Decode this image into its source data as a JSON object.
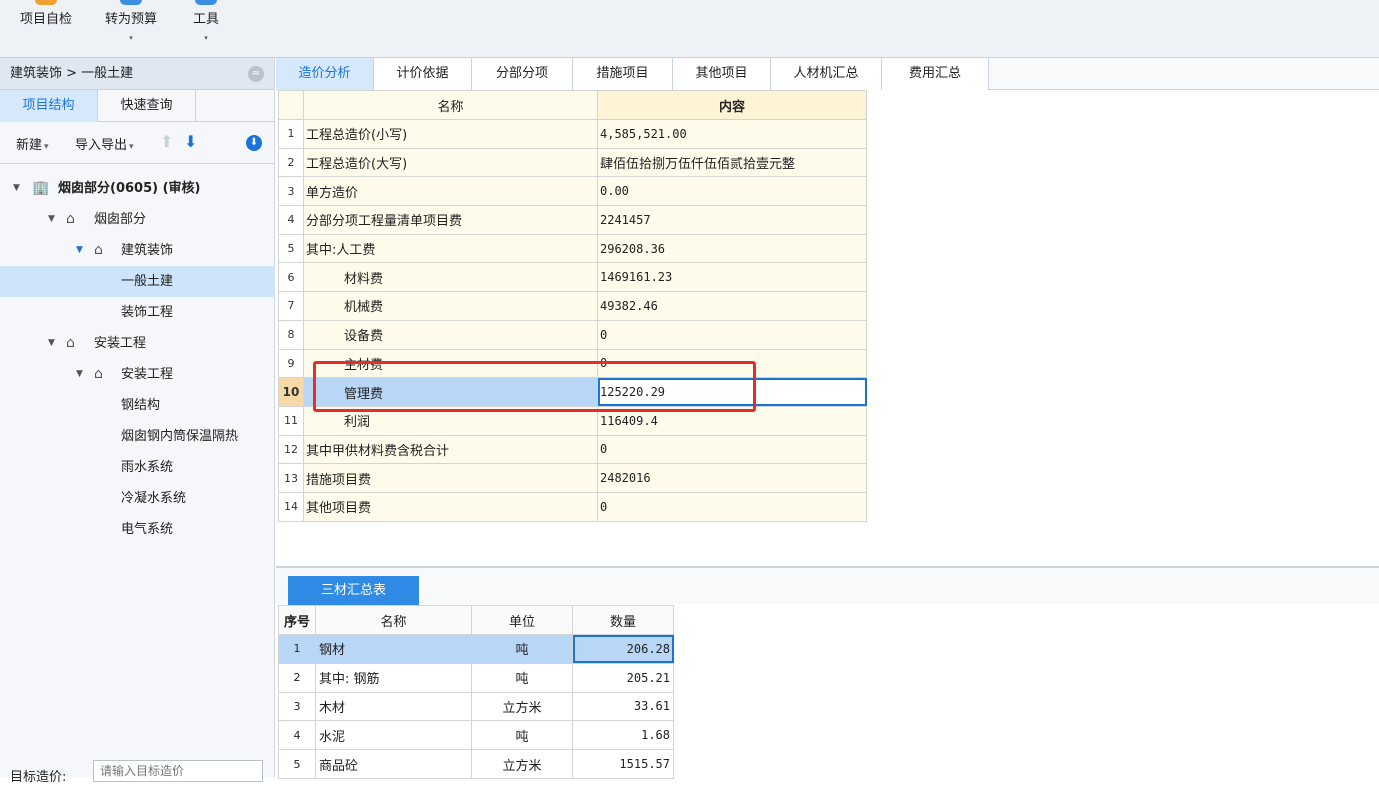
{
  "toolbar": {
    "items": [
      {
        "label": "项目自检",
        "icon": "check-icon",
        "has_menu": false
      },
      {
        "label": "转为预算",
        "icon": "convert-icon",
        "has_menu": true
      },
      {
        "label": "工具",
        "icon": "tools-icon",
        "has_menu": true
      }
    ],
    "caret": "▾"
  },
  "left_panel": {
    "breadcrumb": "建筑装饰 > 一般土建",
    "collapse_glyph": "≈",
    "tabs": [
      "项目结构",
      "快速查询"
    ],
    "actions": {
      "new_label": "新建",
      "import_export_label": "导入导出",
      "menu_glyph": "▾",
      "up_glyph": "⬆",
      "down_glyph": "⬇",
      "download_glyph": "⬇"
    },
    "tree": [
      {
        "label": "烟囱部分(0605) (审核)",
        "caret": "▼",
        "icon": "🏢"
      },
      {
        "label": "烟囱部分",
        "caret": "▼",
        "icon": "⌂"
      },
      {
        "label": "建筑装饰",
        "caret": "▼",
        "icon": "⌂"
      },
      {
        "label": "一般土建"
      },
      {
        "label": "装饰工程"
      },
      {
        "label": "安装工程",
        "caret": "▼",
        "icon": "⌂"
      },
      {
        "label": "安装工程",
        "caret": "▼",
        "icon": "⌂"
      },
      {
        "label": "钢结构"
      },
      {
        "label": "烟囱钢内筒保温隔热"
      },
      {
        "label": "雨水系统"
      },
      {
        "label": "冷凝水系统"
      },
      {
        "label": "电气系统"
      }
    ],
    "target_label": "目标造价:",
    "target_placeholder": "请输入目标造价"
  },
  "main_tabs": [
    "造价分析",
    "计价依据",
    "分部分项",
    "措施项目",
    "其他项目",
    "人材机汇总",
    "费用汇总"
  ],
  "summary": {
    "headers": {
      "name": "名称",
      "content": "内容"
    },
    "rows": [
      {
        "no": "1",
        "name": "工程总造价(小写)",
        "value": "4,585,521.00"
      },
      {
        "no": "2",
        "name": "工程总造价(大写)",
        "value": "肆佰伍拾捌万伍仟伍佰贰拾壹元整"
      },
      {
        "no": "3",
        "name": "单方造价",
        "value": "0.00"
      },
      {
        "no": "4",
        "name": "分部分项工程量清单项目费",
        "value": "2241457"
      },
      {
        "no": "5",
        "name": "其中:人工费",
        "value": "296208.36"
      },
      {
        "no": "6",
        "name": "材料费",
        "value": "1469161.23"
      },
      {
        "no": "7",
        "name": "机械费",
        "value": "49382.46"
      },
      {
        "no": "8",
        "name": "设备费",
        "value": "0"
      },
      {
        "no": "9",
        "name": "主材费",
        "value": "0"
      },
      {
        "no": "10",
        "name": "管理费",
        "value": "125220.29"
      },
      {
        "no": "11",
        "name": "利润",
        "value": "116409.4"
      },
      {
        "no": "12",
        "name": "其中甲供材料费含税合计",
        "value": "0"
      },
      {
        "no": "13",
        "name": "措施项目费",
        "value": "2482016"
      },
      {
        "no": "14",
        "name": "其他项目费",
        "value": "0"
      }
    ]
  },
  "materials": {
    "tab_label": "三材汇总表",
    "headers": {
      "seq": "序号",
      "name": "名称",
      "unit": "单位",
      "qty": "数量"
    },
    "rows": [
      {
        "no": "1",
        "name": "钢材",
        "unit": "吨",
        "qty": "206.28"
      },
      {
        "no": "2",
        "name": "其中: 钢筋",
        "unit": "吨",
        "qty": "205.21"
      },
      {
        "no": "3",
        "name": "木材",
        "unit": "立方米",
        "qty": "33.61"
      },
      {
        "no": "4",
        "name": "水泥",
        "unit": "吨",
        "qty": "1.68"
      },
      {
        "no": "5",
        "name": "商品砼",
        "unit": "立方米",
        "qty": "1515.57"
      }
    ]
  },
  "colors": {
    "accent": "#1a73d9",
    "highlight": "#e82c2c",
    "cell_bg": "#fffbea"
  }
}
